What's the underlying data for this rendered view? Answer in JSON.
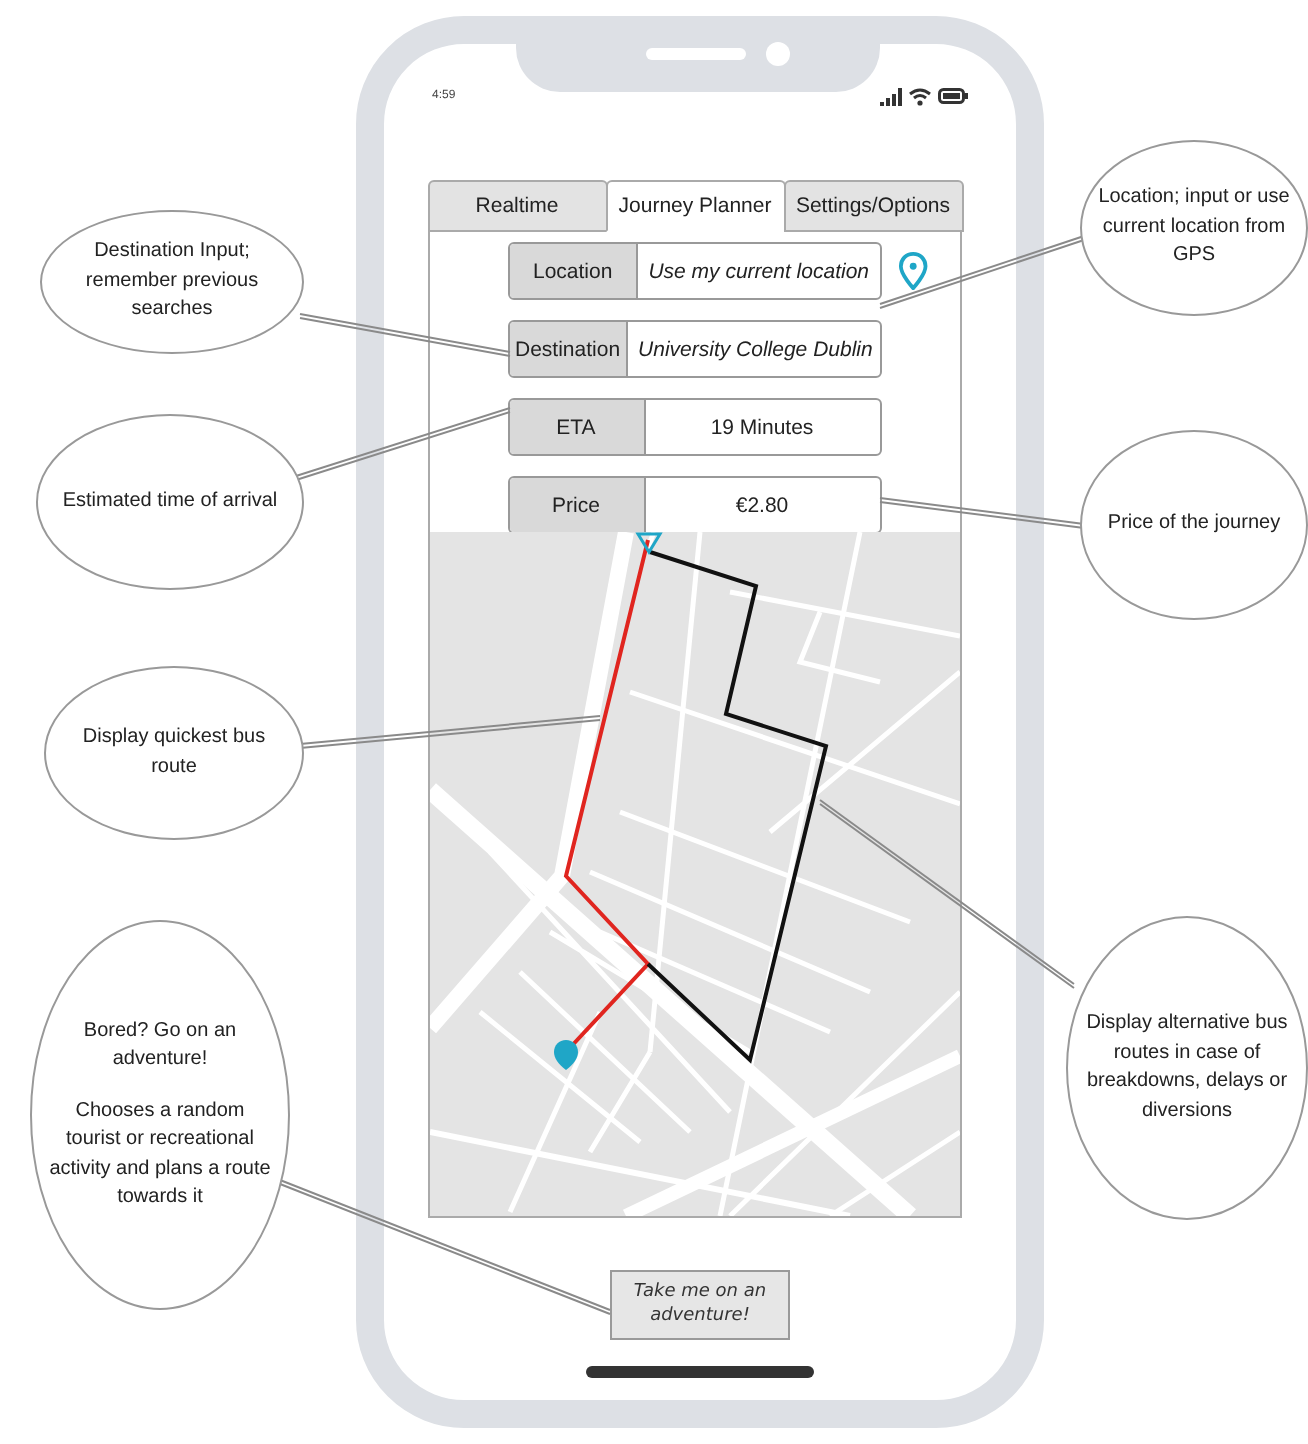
{
  "status_bar": {
    "time": "4:59"
  },
  "tabs": [
    {
      "label": "Realtime",
      "selected": false
    },
    {
      "label": "Journey Planner",
      "selected": true
    },
    {
      "label": "Settings/Options",
      "selected": false
    }
  ],
  "fields": [
    {
      "label": "Location",
      "value": "Use my current location",
      "kind": "input",
      "location_pin": true
    },
    {
      "label": "Destination",
      "value": "University College Dublin",
      "kind": "input",
      "location_pin": false
    },
    {
      "label": "ETA",
      "value": "19 Minutes",
      "kind": "output",
      "location_pin": false
    },
    {
      "label": "Price",
      "value": "€2.80",
      "kind": "output",
      "location_pin": false
    }
  ],
  "adventure_button": {
    "label": "Take me on an adventure!"
  },
  "annotations": [
    {
      "paragraphs": [
        "Destination Input; remember previous searches"
      ]
    },
    {
      "paragraphs": [
        "Estimated time of arrival"
      ]
    },
    {
      "paragraphs": [
        "Display quickest bus route"
      ]
    },
    {
      "paragraphs": [
        "Bored? Go on an adventure!",
        "Chooses a random tourist or recreational activity and plans a route towards it"
      ]
    },
    {
      "paragraphs": [
        "Location; input or use current location from GPS"
      ]
    },
    {
      "paragraphs": [
        "Price of the journey"
      ]
    },
    {
      "paragraphs": [
        "Display alternative bus routes in case of breakdowns, delays or diversions"
      ]
    }
  ]
}
